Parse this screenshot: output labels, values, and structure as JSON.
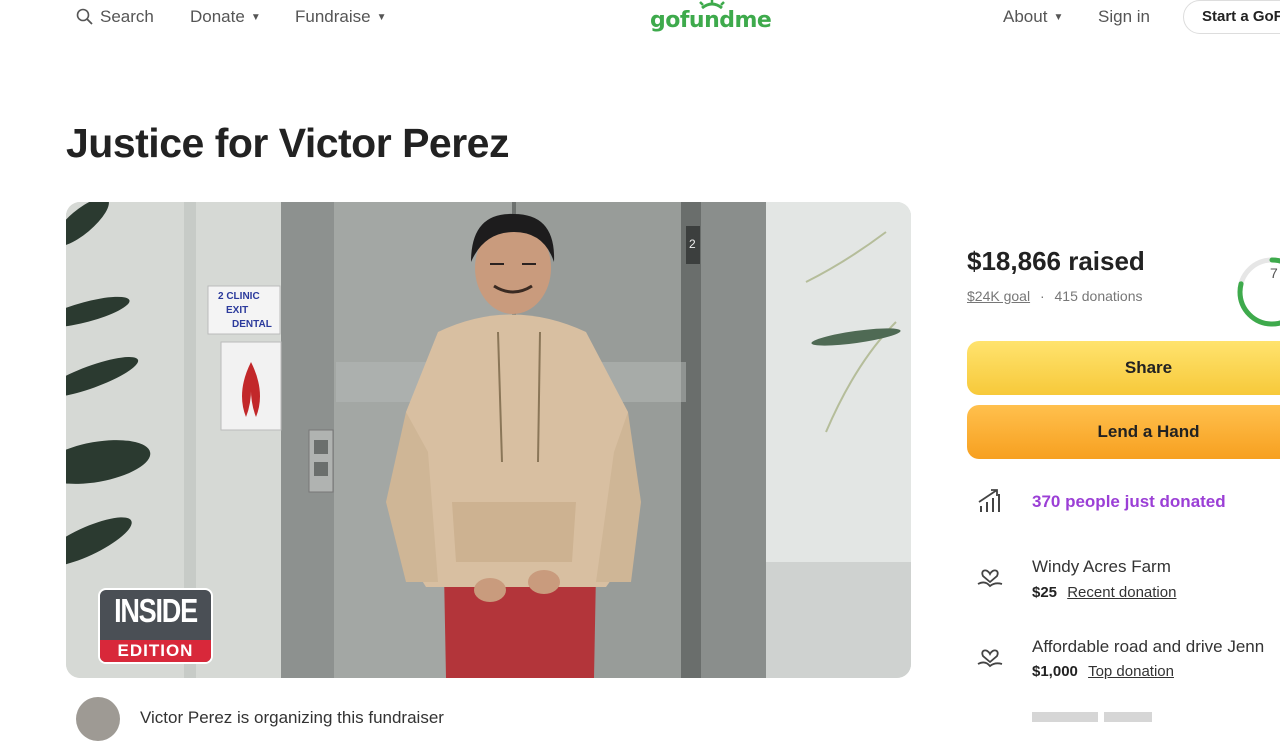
{
  "nav": {
    "search_label": "Search",
    "donate_label": "Donate",
    "fundraise_label": "Fundraise",
    "logo_text": "gofundme",
    "about_label": "About",
    "signin_label": "Sign in",
    "start_label": "Start a GoFundMe"
  },
  "campaign": {
    "title": "Justice for Victor Perez",
    "organizer_text": "Victor Perez is organizing this fundraiser"
  },
  "watermark": {
    "top": "INSIDE",
    "bottom": "EDITION"
  },
  "photo_signs": {
    "line1": "2 CLINIC",
    "line2": "EXIT",
    "line3": "DENTAL",
    "floor": "2"
  },
  "donation": {
    "raised": "$18,866 raised",
    "goal": "$24K goal",
    "separator": "·",
    "count": "415 donations",
    "progress_percent": 79,
    "ring_label": "7"
  },
  "buttons": {
    "share": "Share",
    "lend": "Lend a Hand"
  },
  "activity": {
    "just_donated": "370 people just donated",
    "donors": [
      {
        "name": "Windy Acres Farm",
        "amount": "$25",
        "tag": "Recent donation"
      },
      {
        "name": "Affordable road and drive Jenn",
        "amount": "$1,000",
        "tag": "Top donation"
      }
    ]
  },
  "colors": {
    "brand_green": "#3eaa4c",
    "share_yellow": "#f7c93a",
    "lend_orange": "#f7a020",
    "activity_purple": "#9b3fd6"
  }
}
